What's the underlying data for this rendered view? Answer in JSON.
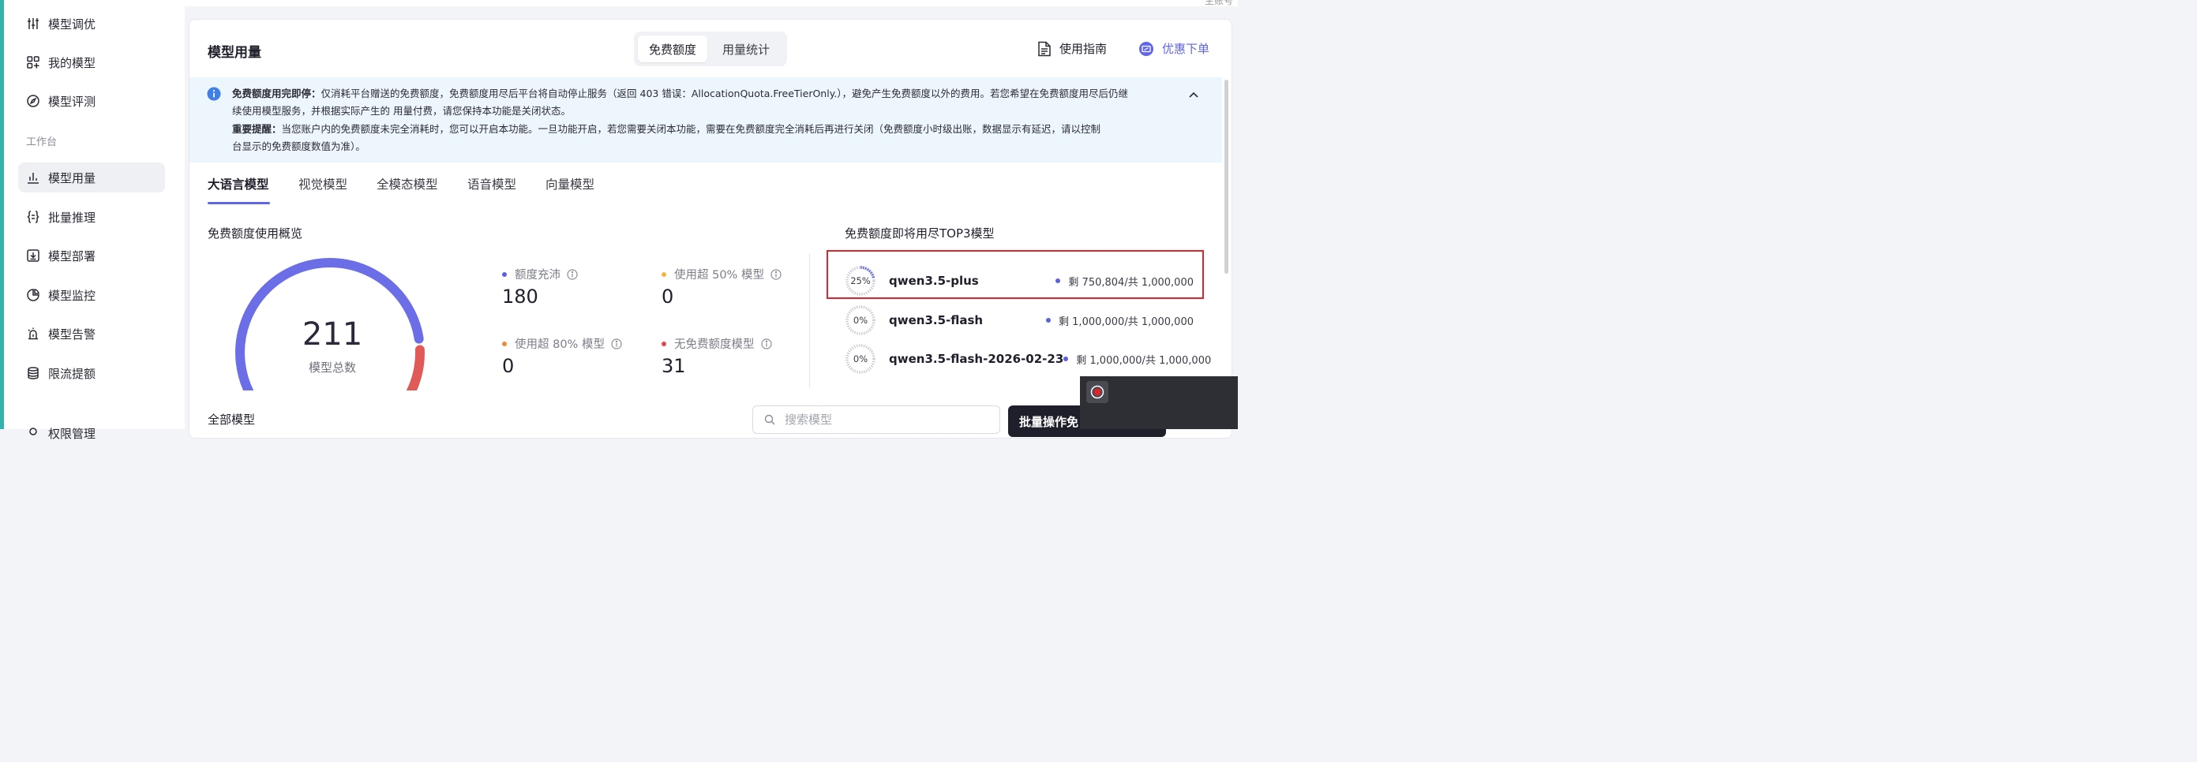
{
  "account_text": "主账号",
  "sidebar": {
    "items": [
      {
        "label": "模型调优",
        "icon": "sliders-icon"
      },
      {
        "label": "我的模型",
        "icon": "grid-icon"
      },
      {
        "label": "模型评测",
        "icon": "compass-icon"
      }
    ],
    "group_label": "工作台",
    "workbench": [
      {
        "label": "模型用量",
        "icon": "bar-chart-icon",
        "active": true
      },
      {
        "label": "批量推理",
        "icon": "braces-icon"
      },
      {
        "label": "模型部署",
        "icon": "download-box-icon"
      },
      {
        "label": "模型监控",
        "icon": "pie-chart-icon"
      },
      {
        "label": "模型告警",
        "icon": "alarm-icon"
      },
      {
        "label": "限流提额",
        "icon": "database-icon"
      },
      {
        "label": "权限管理",
        "icon": "key-icon"
      }
    ]
  },
  "header": {
    "title": "模型用量",
    "segments": [
      "免费额度",
      "用量统计"
    ],
    "active_segment": "免费额度",
    "guide_label": "使用指南",
    "discount_label": "优惠下单"
  },
  "notice": {
    "line1_bold": "免费额度用完即停：",
    "line1": "仅消耗平台赠送的免费额度，免费额度用尽后平台将自动停止服务（返回 403 错误：AllocationQuota.FreeTierOnly.），避免产生免费额度以外的费用。若您希望在免费额度用尽后仍继",
    "line2": "续使用模型服务，并根据实际产生的 用量付费，请您保持本功能是关闭状态。",
    "line3_bold": "重要提醒：",
    "line3": "当您账户内的免费额度未完全消耗时，您可以开启本功能。一旦功能开启，若您需要关闭本功能，需要在免费额度完全消耗后再进行关闭（免费额度小时级出账，数据显示有延迟，请以控制",
    "line4": "台显示的免费额度数值为准）。"
  },
  "tabs": [
    "大语言模型",
    "视觉模型",
    "全模态模型",
    "语音模型",
    "向量模型"
  ],
  "overview": {
    "title": "免费额度使用概览",
    "total_value": "211",
    "total_label": "模型总数",
    "gauge": {
      "ample": 180,
      "over80": 0,
      "none": 31,
      "total": 211
    },
    "stats": [
      {
        "label": "额度充沛",
        "value": "180",
        "color": "#5b5fe0"
      },
      {
        "label": "使用超 50% 模型",
        "value": "0",
        "color": "#f2b737"
      },
      {
        "label": "使用超 80% 模型",
        "value": "0",
        "color": "#e98a3e"
      },
      {
        "label": "无免费额度模型",
        "value": "31",
        "color": "#e0494a"
      }
    ]
  },
  "top3": {
    "title": "免费额度即将用尽TOP3模型",
    "items": [
      {
        "pct": "25%",
        "pct_value": 0.25,
        "name": "qwen3.5-plus",
        "remain": "剩 750,804/共 1,000,000"
      },
      {
        "pct": "0%",
        "pct_value": 0,
        "name": "qwen3.5-flash",
        "remain": "剩 1,000,000/共 1,000,000"
      },
      {
        "pct": "0%",
        "pct_value": 0,
        "name": "qwen3.5-flash-2026-02-23",
        "remain": "剩 1,000,000/共 1,000,000"
      }
    ]
  },
  "all_models": {
    "title": "全部模型",
    "search_placeholder": "搜索模型",
    "batch_label": "批量操作免"
  },
  "colors": {
    "accent": "#6166e8",
    "gauge_primary": "#6b6ee6",
    "gauge_danger": "#e05a57",
    "highlight": "#e0242c"
  }
}
